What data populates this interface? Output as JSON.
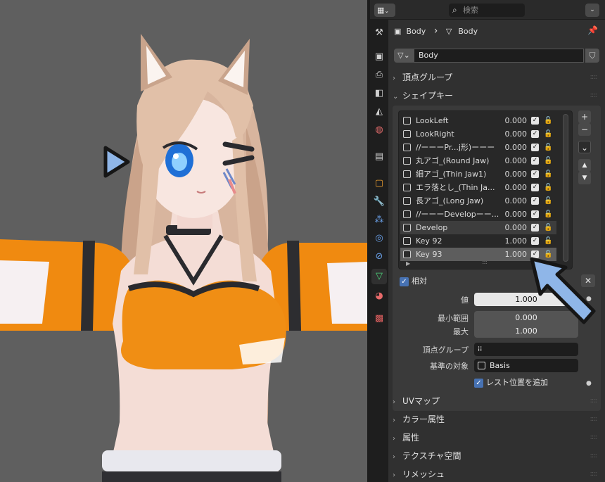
{
  "header": {
    "editor_icon": "properties-editor-icon",
    "search_placeholder": "検索"
  },
  "tabs": [
    "tool-icon",
    "render-icon",
    "output-icon",
    "view-layer-icon",
    "scene-icon",
    "world-icon",
    "collection-icon",
    "object-icon",
    "modifier-icon",
    "particles-icon",
    "physics-icon",
    "constraints-icon",
    "object-data-icon",
    "material-icon",
    "texture-icon"
  ],
  "breadcrumb": {
    "object": "Body",
    "sep": "›",
    "data": "Body"
  },
  "datablock": {
    "name": "Body"
  },
  "panels": {
    "vertex_groups": "頂点グループ",
    "shape_keys": "シェイプキー",
    "uv_maps": "UVマップ",
    "color_attributes": "カラー属性",
    "attributes": "属性",
    "texture_space": "テクスチャ空間",
    "remesh": "リメッシュ"
  },
  "shape_keys": [
    {
      "name": "LookLeft",
      "value": "0.000"
    },
    {
      "name": "LookRight",
      "value": "0.000"
    },
    {
      "name": "//ーーーPr...j形)ーーー",
      "value": "0.000"
    },
    {
      "name": "丸アゴ_(Round Jaw)",
      "value": "0.000"
    },
    {
      "name": "細アゴ_(Thin Jaw1)",
      "value": "0.000"
    },
    {
      "name": "エラ落とし_(Thin Ja...",
      "value": "0.000"
    },
    {
      "name": "長アゴ_(Long Jaw)",
      "value": "0.000"
    },
    {
      "name": "//ーーーDevelopーー...",
      "value": "0.000"
    },
    {
      "name": "Develop",
      "value": "0.000"
    },
    {
      "name": "Key 92",
      "value": "1.000"
    },
    {
      "name": "Key 93",
      "value": "1.000"
    }
  ],
  "shape_key_settings": {
    "relative_label": "相対",
    "value_label": "値",
    "value": "1.000",
    "range_min_label": "最小範囲",
    "range_min": "0.000",
    "range_max_label": "最大",
    "range_max": "1.000",
    "vertex_group_label": "頂点グループ",
    "vertex_group": "",
    "relative_to_label": "基準の対象",
    "relative_to": "Basis",
    "rest_position_label": "レスト位置を追加"
  },
  "side_buttons": {
    "add": "+",
    "remove": "−",
    "specials": "⌄",
    "up": "▲",
    "down": "▼",
    "clear": "✕"
  }
}
